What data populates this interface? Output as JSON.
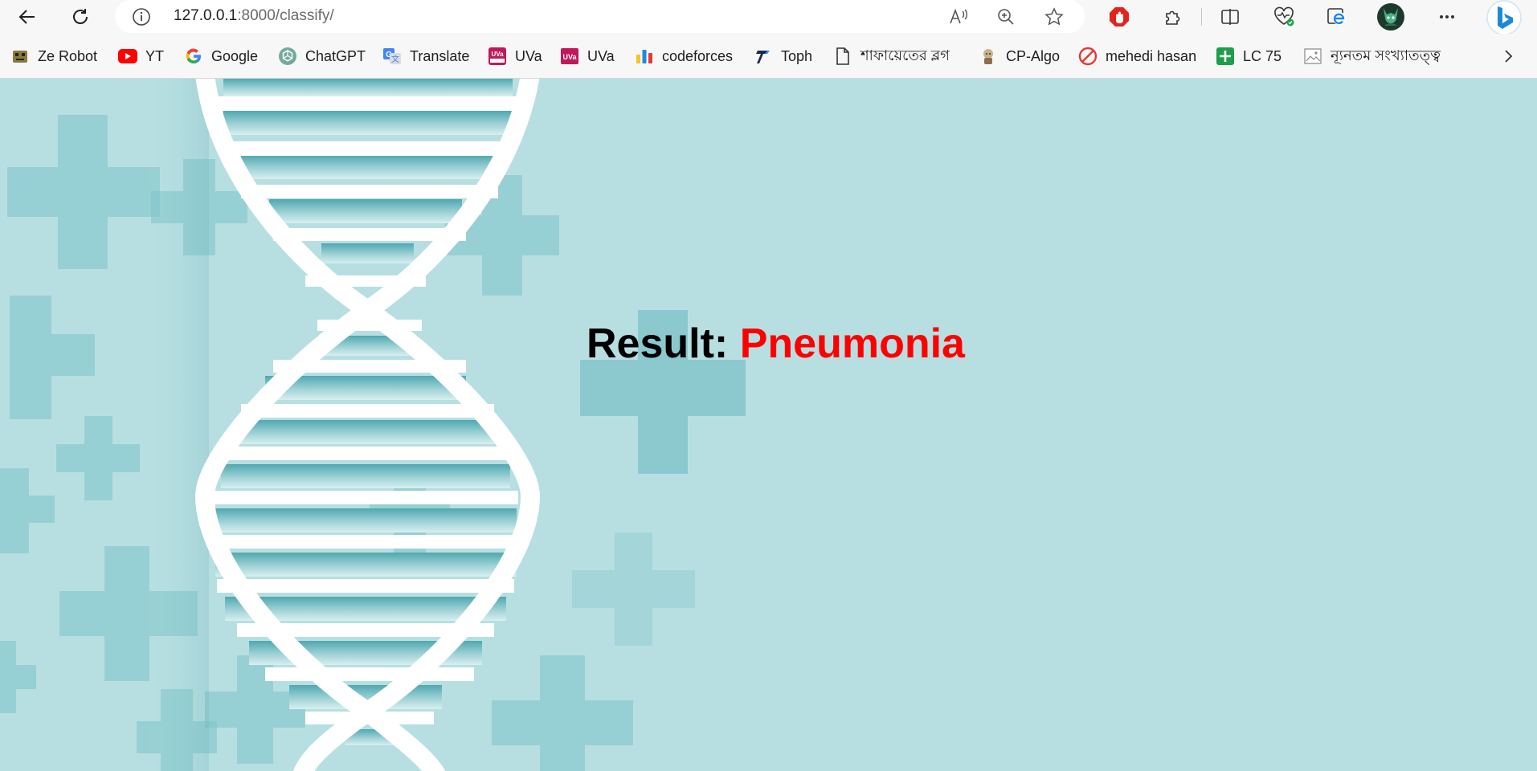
{
  "browser": {
    "url_host": "127.0.0.1",
    "url_port_path": ":8000/classify/"
  },
  "bookmarks": [
    {
      "label": "Ze Robot",
      "icon": "robot-icon"
    },
    {
      "label": "YT",
      "icon": "youtube-icon"
    },
    {
      "label": "Google",
      "icon": "google-icon"
    },
    {
      "label": "ChatGPT",
      "icon": "chatgpt-icon"
    },
    {
      "label": "Translate",
      "icon": "translate-icon"
    },
    {
      "label": "UVa",
      "icon": "uva-hunting-icon"
    },
    {
      "label": "UVa",
      "icon": "uva-icon"
    },
    {
      "label": "codeforces",
      "icon": "codeforces-icon"
    },
    {
      "label": "Toph",
      "icon": "toph-icon"
    },
    {
      "label": "শাফায়েতের ব্লগ",
      "icon": "page-icon"
    },
    {
      "label": "CP-Algo",
      "icon": "cp-algo-icon"
    },
    {
      "label": "mehedi hasan",
      "icon": "no-sign-icon"
    },
    {
      "label": "LC 75",
      "icon": "plus-icon"
    },
    {
      "label": "ন্যূনতম সংখ্যাতত্ত্ব",
      "icon": "image-icon"
    }
  ],
  "result": {
    "label": "Result:",
    "value": "Pneumonia"
  },
  "colors": {
    "page_background": "#b7dfe2",
    "result_value": "#ff0000"
  }
}
